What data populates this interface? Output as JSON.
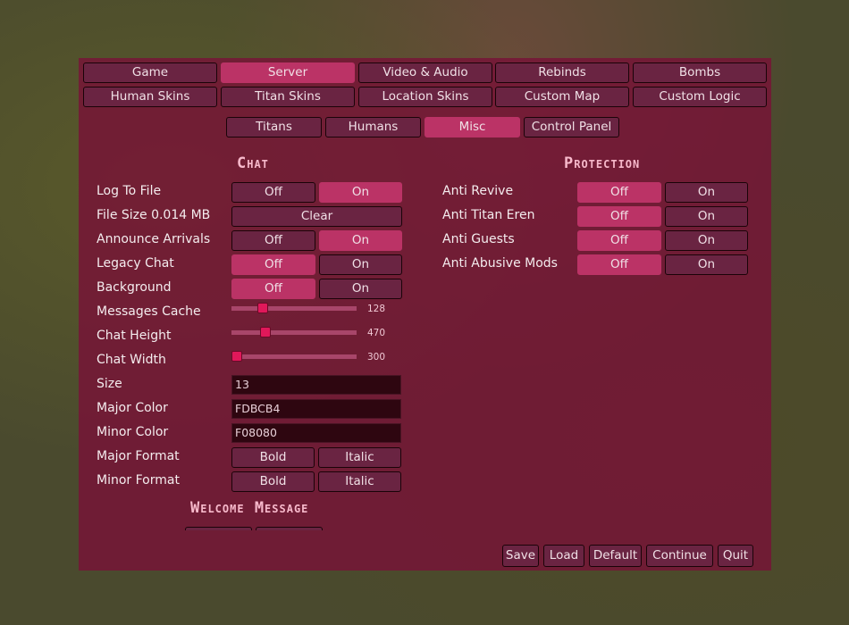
{
  "tabs_row1": [
    {
      "label": "Game",
      "active": false
    },
    {
      "label": "Server",
      "active": true
    },
    {
      "label": "Video & Audio",
      "active": false
    },
    {
      "label": "Rebinds",
      "active": false
    },
    {
      "label": "Bombs",
      "active": false
    }
  ],
  "tabs_row2": [
    {
      "label": "Human Skins"
    },
    {
      "label": "Titan Skins"
    },
    {
      "label": "Location Skins"
    },
    {
      "label": "Custom Map"
    },
    {
      "label": "Custom Logic"
    }
  ],
  "subtabs": [
    {
      "label": "Titans",
      "active": false
    },
    {
      "label": "Humans",
      "active": false
    },
    {
      "label": "Misc",
      "active": true
    },
    {
      "label": "Control Panel",
      "active": false
    }
  ],
  "chat": {
    "title": "Chat",
    "log_to_file": {
      "label": "Log To File",
      "off": "Off",
      "on": "On",
      "value": "On"
    },
    "file_size": {
      "label": "File Size 0.014 MB",
      "button": "Clear"
    },
    "announce_arrivals": {
      "label": "Announce Arrivals",
      "off": "Off",
      "on": "On",
      "value": "On"
    },
    "legacy_chat": {
      "label": "Legacy Chat",
      "off": "Off",
      "on": "On",
      "value": "Off"
    },
    "background": {
      "label": "Background",
      "off": "Off",
      "on": "On",
      "value": "Off"
    },
    "messages_cache": {
      "label": "Messages Cache",
      "value": "128",
      "fraction": 0.25
    },
    "chat_height": {
      "label": "Chat Height",
      "value": "470",
      "fraction": 0.27
    },
    "chat_width": {
      "label": "Chat Width",
      "value": "300",
      "fraction": 0.0
    },
    "size": {
      "label": "Size",
      "value": "13"
    },
    "major_color": {
      "label": "Major Color",
      "value": "FDBCB4"
    },
    "minor_color": {
      "label": "Minor Color",
      "value": "F08080"
    },
    "major_format": {
      "label": "Major Format",
      "bold": "Bold",
      "italic": "Italic"
    },
    "minor_format": {
      "label": "Minor Format",
      "bold": "Bold",
      "italic": "Italic"
    }
  },
  "welcome": {
    "title": "Welcome Message"
  },
  "protection": {
    "title": "Protection",
    "items": [
      {
        "label": "Anti Revive",
        "off": "Off",
        "on": "On",
        "value": "Off"
      },
      {
        "label": "Anti Titan Eren",
        "off": "Off",
        "on": "On",
        "value": "Off"
      },
      {
        "label": "Anti Guests",
        "off": "Off",
        "on": "On",
        "value": "Off"
      },
      {
        "label": "Anti Abusive Mods",
        "off": "Off",
        "on": "On",
        "value": "Off"
      }
    ]
  },
  "footer": {
    "save": "Save",
    "load": "Load",
    "default": "Default",
    "continue": "Continue",
    "quit": "Quit"
  },
  "colors": {
    "accent": "#bb3366",
    "button": "#6a2442",
    "panel": "#78123a",
    "title": "#f7b9cb"
  }
}
